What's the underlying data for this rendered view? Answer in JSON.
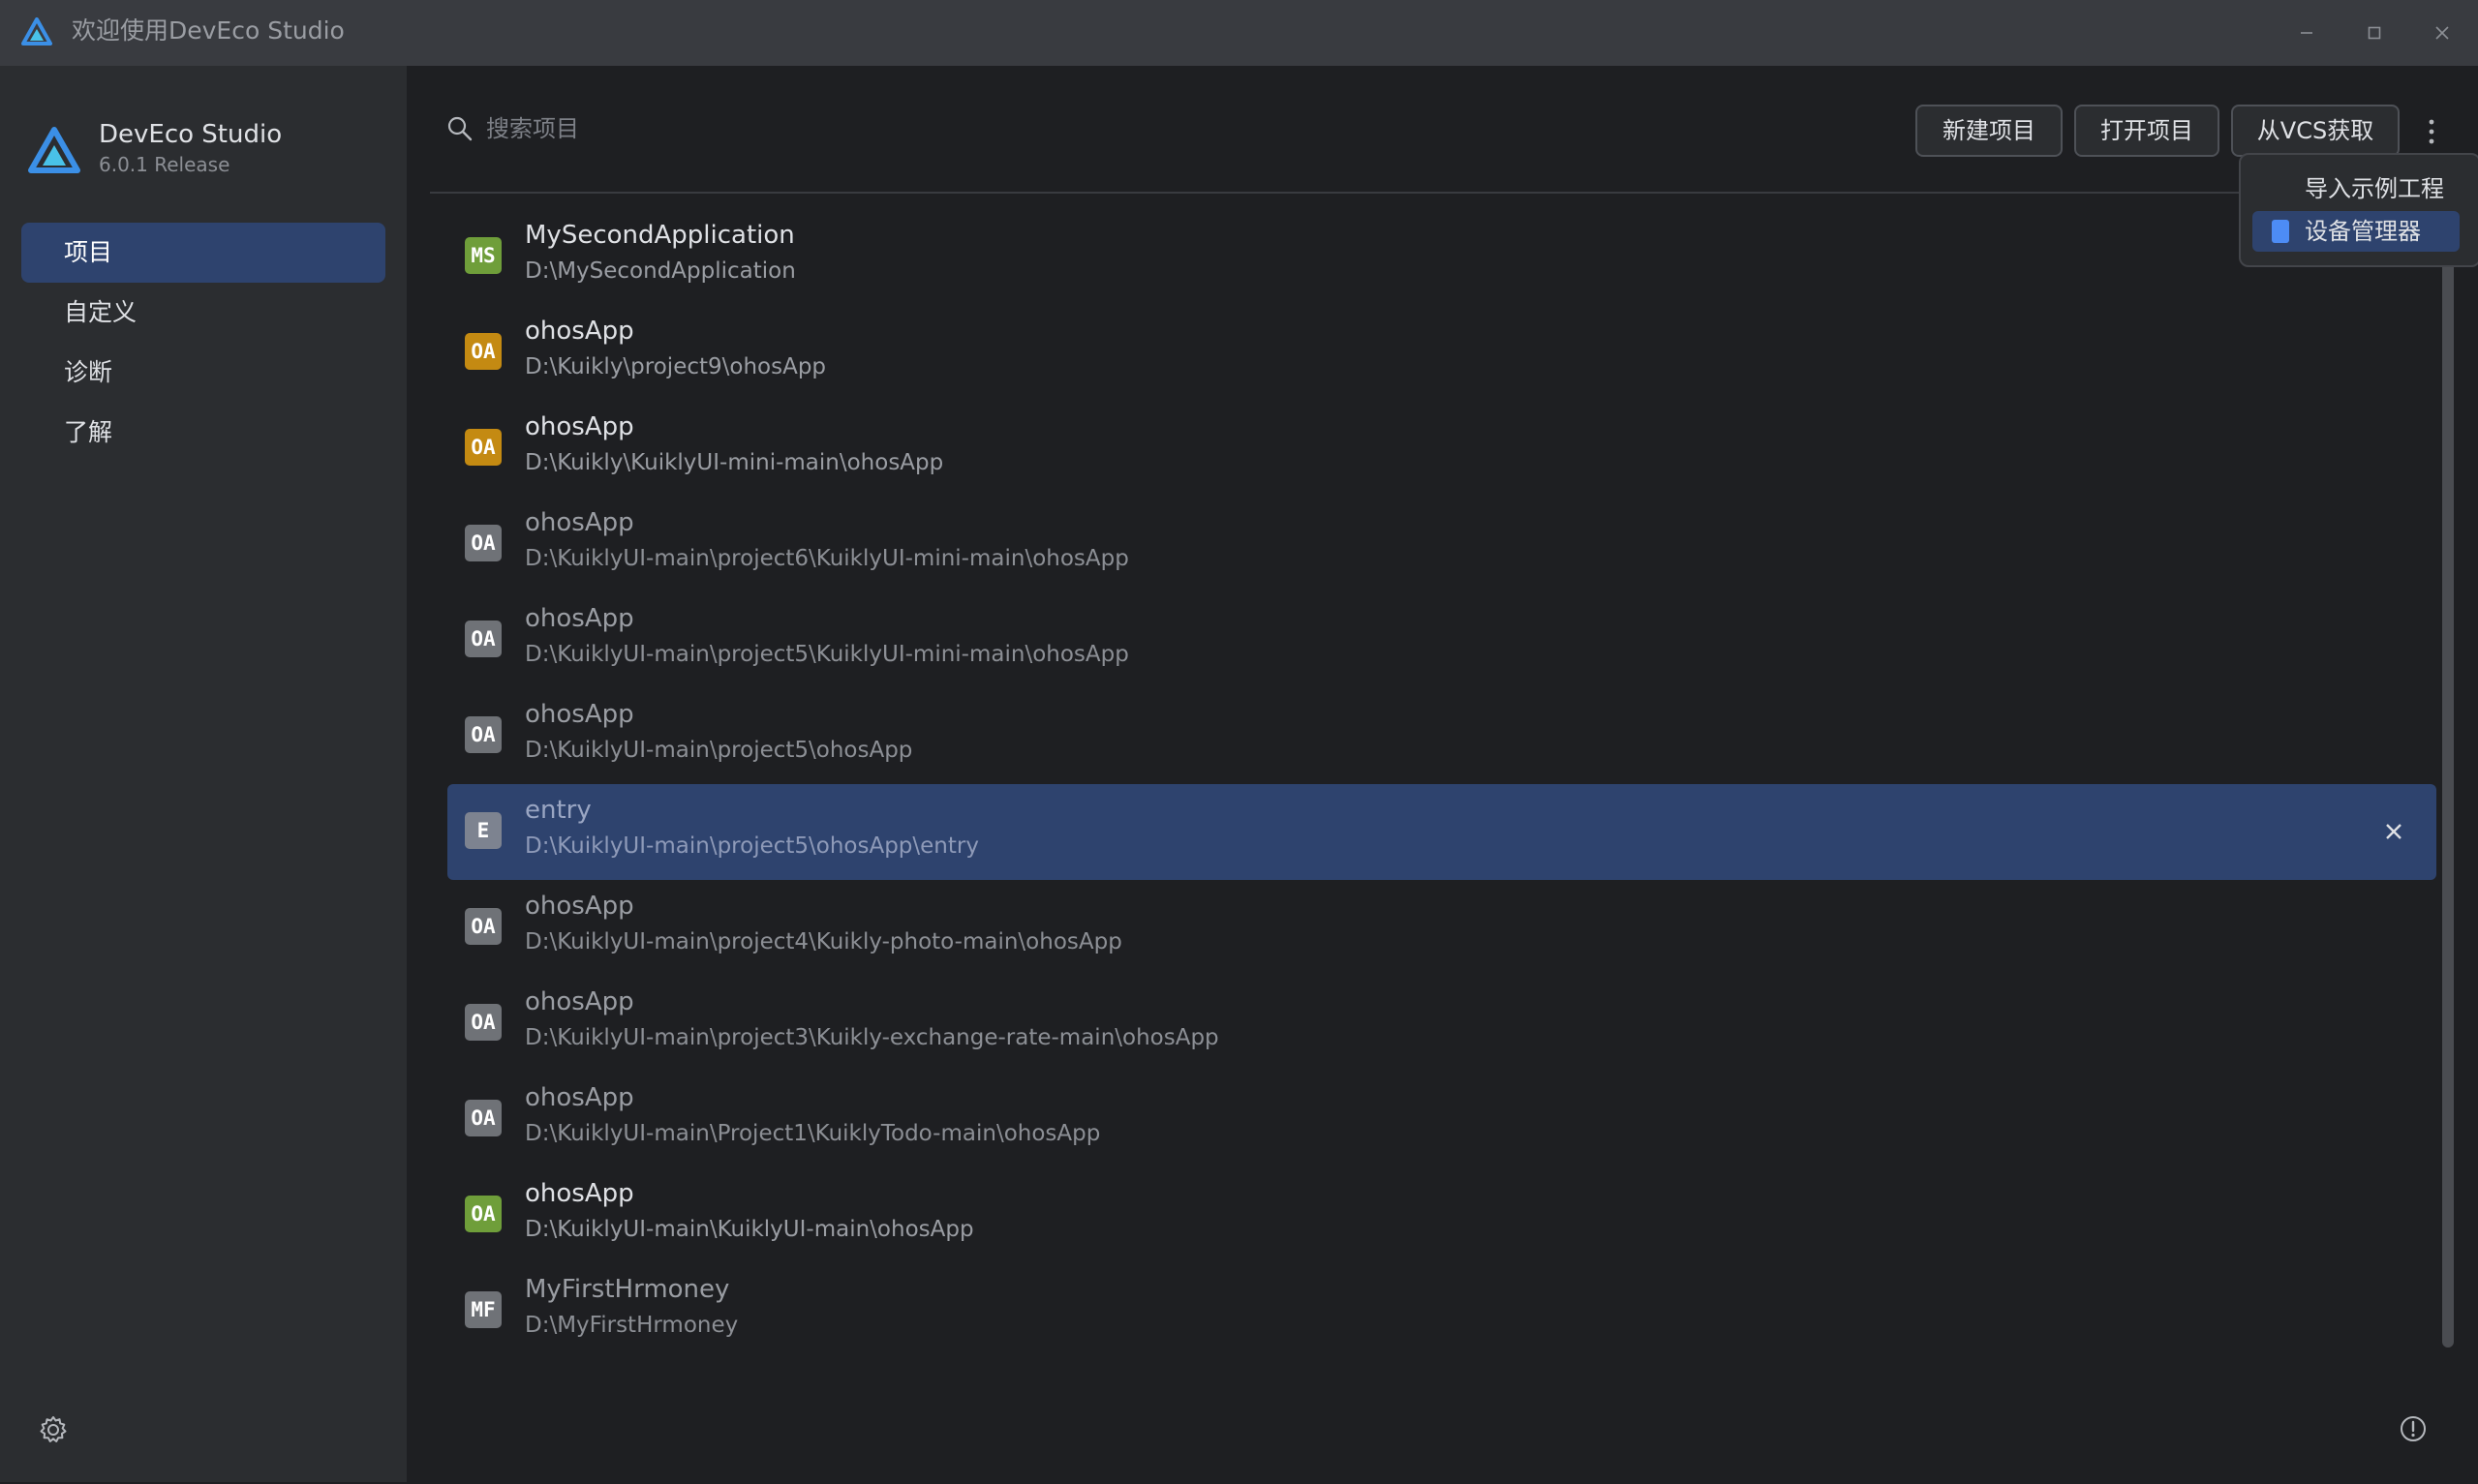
{
  "window": {
    "title": "欢迎使用DevEco Studio"
  },
  "sidebar": {
    "brand_name": "DevEco Studio",
    "brand_version": "6.0.1 Release",
    "items": [
      {
        "label": "项目",
        "active": true
      },
      {
        "label": "自定义",
        "active": false
      },
      {
        "label": "诊断",
        "active": false
      },
      {
        "label": "了解",
        "active": false
      }
    ]
  },
  "header": {
    "search_placeholder": "搜索项目",
    "new_project": "新建项目",
    "open_project": "打开项目",
    "get_from_vcs": "从VCS获取"
  },
  "dropdown": {
    "items": [
      {
        "label": "导入示例工程",
        "icon": "none"
      },
      {
        "label": "设备管理器",
        "icon": "device-icon",
        "active": true
      }
    ]
  },
  "projects": [
    {
      "badge": "MS",
      "name": "MySecondApplication",
      "path": "D:\\MySecondApplication",
      "badge_color": "#6f9e3a",
      "dim": false
    },
    {
      "badge": "OA",
      "name": "ohosApp",
      "path": "D:\\Kuikly\\project9\\ohosApp",
      "badge_color": "#c48a12",
      "dim": false
    },
    {
      "badge": "OA",
      "name": "ohosApp",
      "path": "D:\\Kuikly\\KuiklyUI-mini-main\\ohosApp",
      "badge_color": "#c48a12",
      "dim": false
    },
    {
      "badge": "OA",
      "name": "ohosApp",
      "path": "D:\\KuiklyUI-main\\project6\\KuiklyUI-mini-main\\ohosApp",
      "badge_color": "#6f7277",
      "dim": true
    },
    {
      "badge": "OA",
      "name": "ohosApp",
      "path": "D:\\KuiklyUI-main\\project5\\KuiklyUI-mini-main\\ohosApp",
      "badge_color": "#6f7277",
      "dim": true
    },
    {
      "badge": "OA",
      "name": "ohosApp",
      "path": "D:\\KuiklyUI-main\\project5\\ohosApp",
      "badge_color": "#6f7277",
      "dim": true
    },
    {
      "badge": "E",
      "name": "entry",
      "path": "D:\\KuiklyUI-main\\project5\\ohosApp\\entry",
      "badge_color": "#7d8390",
      "dim": true,
      "selected": true
    },
    {
      "badge": "OA",
      "name": "ohosApp",
      "path": "D:\\KuiklyUI-main\\project4\\Kuikly-photo-main\\ohosApp",
      "badge_color": "#6f7277",
      "dim": true
    },
    {
      "badge": "OA",
      "name": "ohosApp",
      "path": "D:\\KuiklyUI-main\\project3\\Kuikly-exchange-rate-main\\ohosApp",
      "badge_color": "#6f7277",
      "dim": true
    },
    {
      "badge": "OA",
      "name": "ohosApp",
      "path": "D:\\KuiklyUI-main\\Project1\\KuiklyTodo-main\\ohosApp",
      "badge_color": "#6f7277",
      "dim": true
    },
    {
      "badge": "OA",
      "name": "ohosApp",
      "path": "D:\\KuiklyUI-main\\KuiklyUI-main\\ohosApp",
      "badge_color": "#6f9e3a",
      "dim": false
    },
    {
      "badge": "MF",
      "name": "MyFirstHrmoney",
      "path": "D:\\MyFirstHrmoney",
      "badge_color": "#6f7277",
      "dim": true
    }
  ],
  "colors": {
    "accent": "#2e436e",
    "background": "#1e1f22",
    "sidebar": "#2b2d30",
    "titlebar": "#393b40"
  }
}
